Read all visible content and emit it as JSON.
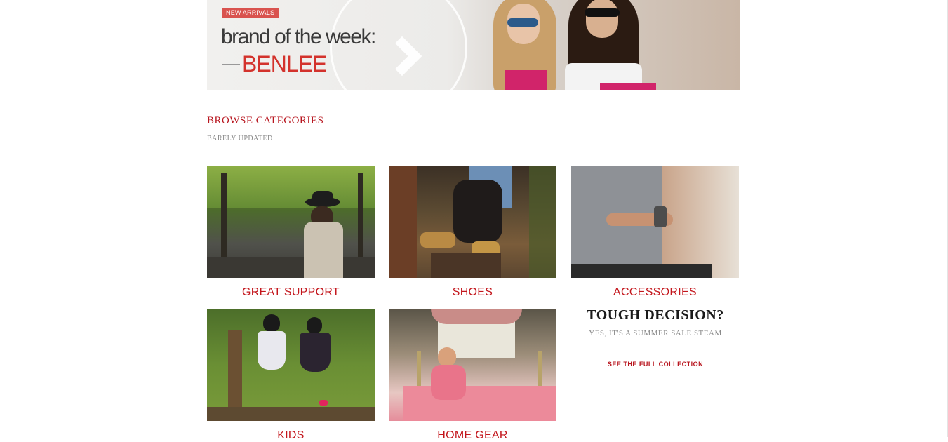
{
  "banner": {
    "badge": "NEW ARRIVALS",
    "headline": "brand of the week:",
    "brand": "BENLEE"
  },
  "section": {
    "title": "BROWSE CATEGORIES",
    "subtitle": "BARELY UPDATED"
  },
  "categories": [
    {
      "label": "GREAT SUPPORT"
    },
    {
      "label": "SHOES"
    },
    {
      "label": "ACCESSORIES"
    },
    {
      "label": "KIDS"
    },
    {
      "label": "HOME GEAR"
    }
  ],
  "promo": {
    "title": "TOUGH DECISION?",
    "subtitle": "YES, IT'S A SUMMER SALE STEAM",
    "link": "SEE THE FULL COLLECTION"
  },
  "colors": {
    "accent": "#c3161c",
    "badge": "#d9534f"
  }
}
